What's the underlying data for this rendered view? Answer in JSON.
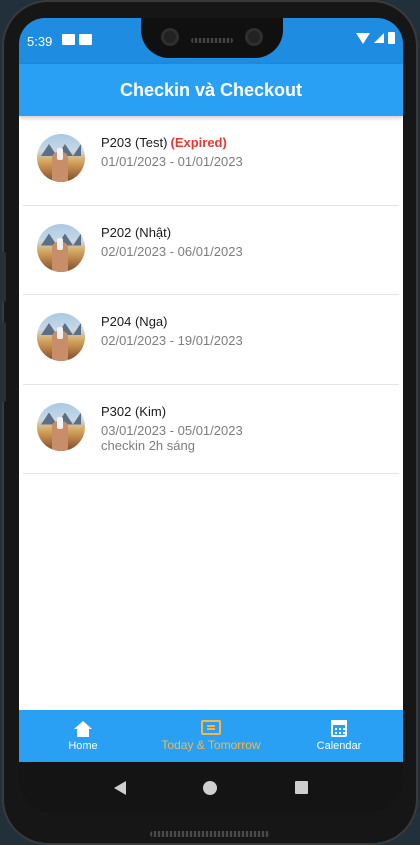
{
  "status_bar": {
    "time": "5:39"
  },
  "app_bar": {
    "title": "Checkin và Checkout"
  },
  "bookings": [
    {
      "room": "P203 (Test)",
      "badge": "(Expired)",
      "dates": "01/01/2023 - 01/01/2023",
      "note": ""
    },
    {
      "room": "P202 (Nhật)",
      "badge": "",
      "dates": "02/01/2023 - 06/01/2023",
      "note": ""
    },
    {
      "room": "P204 (Nga)",
      "badge": "",
      "dates": "02/01/2023 - 19/01/2023",
      "note": ""
    },
    {
      "room": "P302 (Kim)",
      "badge": "",
      "dates": "03/01/2023 - 05/01/2023",
      "note": "checkin 2h sáng"
    }
  ],
  "bottom_nav": {
    "home": "Home",
    "today": "Today & Tomorrow",
    "calendar": "Calendar",
    "active": "today"
  },
  "colors": {
    "primary": "#2aa0f5",
    "active_tab": "#f5b74a",
    "expired": "#e53935"
  },
  "icons": {
    "home": "home-icon",
    "today": "today-tomorrow-icon",
    "calendar": "calendar-icon",
    "back": "back-triangle-icon",
    "system_home": "home-circle-icon",
    "recents": "recents-square-icon"
  }
}
